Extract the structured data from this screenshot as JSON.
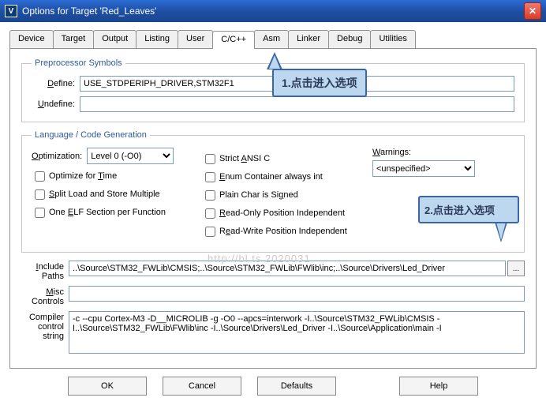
{
  "window": {
    "title": "Options for Target 'Red_Leaves'",
    "app_icon_letter": "V",
    "close_glyph": "✕"
  },
  "tabs": [
    "Device",
    "Target",
    "Output",
    "Listing",
    "User",
    "C/C++",
    "Asm",
    "Linker",
    "Debug",
    "Utilities"
  ],
  "active_tab_index": 5,
  "preproc": {
    "legend": "Preprocessor Symbols",
    "define_label": "Define:",
    "define_value": "USE_STDPERIPH_DRIVER,STM32F1",
    "undefine_label": "Undefine:",
    "undefine_value": ""
  },
  "langgen": {
    "legend": "Language / Code Generation",
    "optimization_label": "Optimization:",
    "optimization_value": "Level 0 (-O0)",
    "optimize_time": "Optimize for Time",
    "split_load": "Split Load and Store Multiple",
    "one_elf": "One ELF Section per Function",
    "strict_ansi": "Strict ANSI C",
    "enum_container": "Enum Container always int",
    "plain_char": "Plain Char is Signed",
    "readonly_pi": "Read-Only Position Independent",
    "readwrite_pi": "Read-Write Position Independent",
    "warnings_label": "Warnings:",
    "warnings_value": "<unspecified>"
  },
  "paths": {
    "include_label": "Include\nPaths",
    "include_value": "..\\Source\\STM32_FWLib\\CMSIS;..\\Source\\STM32_FWLib\\FWlib\\inc;..\\Source\\Drivers\\Led_Driver",
    "misc_label": "Misc\nControls",
    "misc_value": "",
    "compiler_label": "Compiler\ncontrol\nstring",
    "compiler_value": "-c --cpu Cortex-M3 -D__MICROLIB -g -O0 --apcs=interwork -I..\\Source\\STM32_FWLib\\CMSIS -I..\\Source\\STM32_FWLib\\FWlib\\inc -I..\\Source\\Drivers\\Led_Driver -I..\\Source\\Application\\main -I",
    "browse_glyph": "..."
  },
  "buttons": {
    "ok": "OK",
    "cancel": "Cancel",
    "defaults": "Defaults",
    "help": "Help"
  },
  "callouts": {
    "c1": "1.点击进入选项",
    "c2": "2.点击进入选项"
  },
  "watermark": "http://bl              ts   2020031"
}
